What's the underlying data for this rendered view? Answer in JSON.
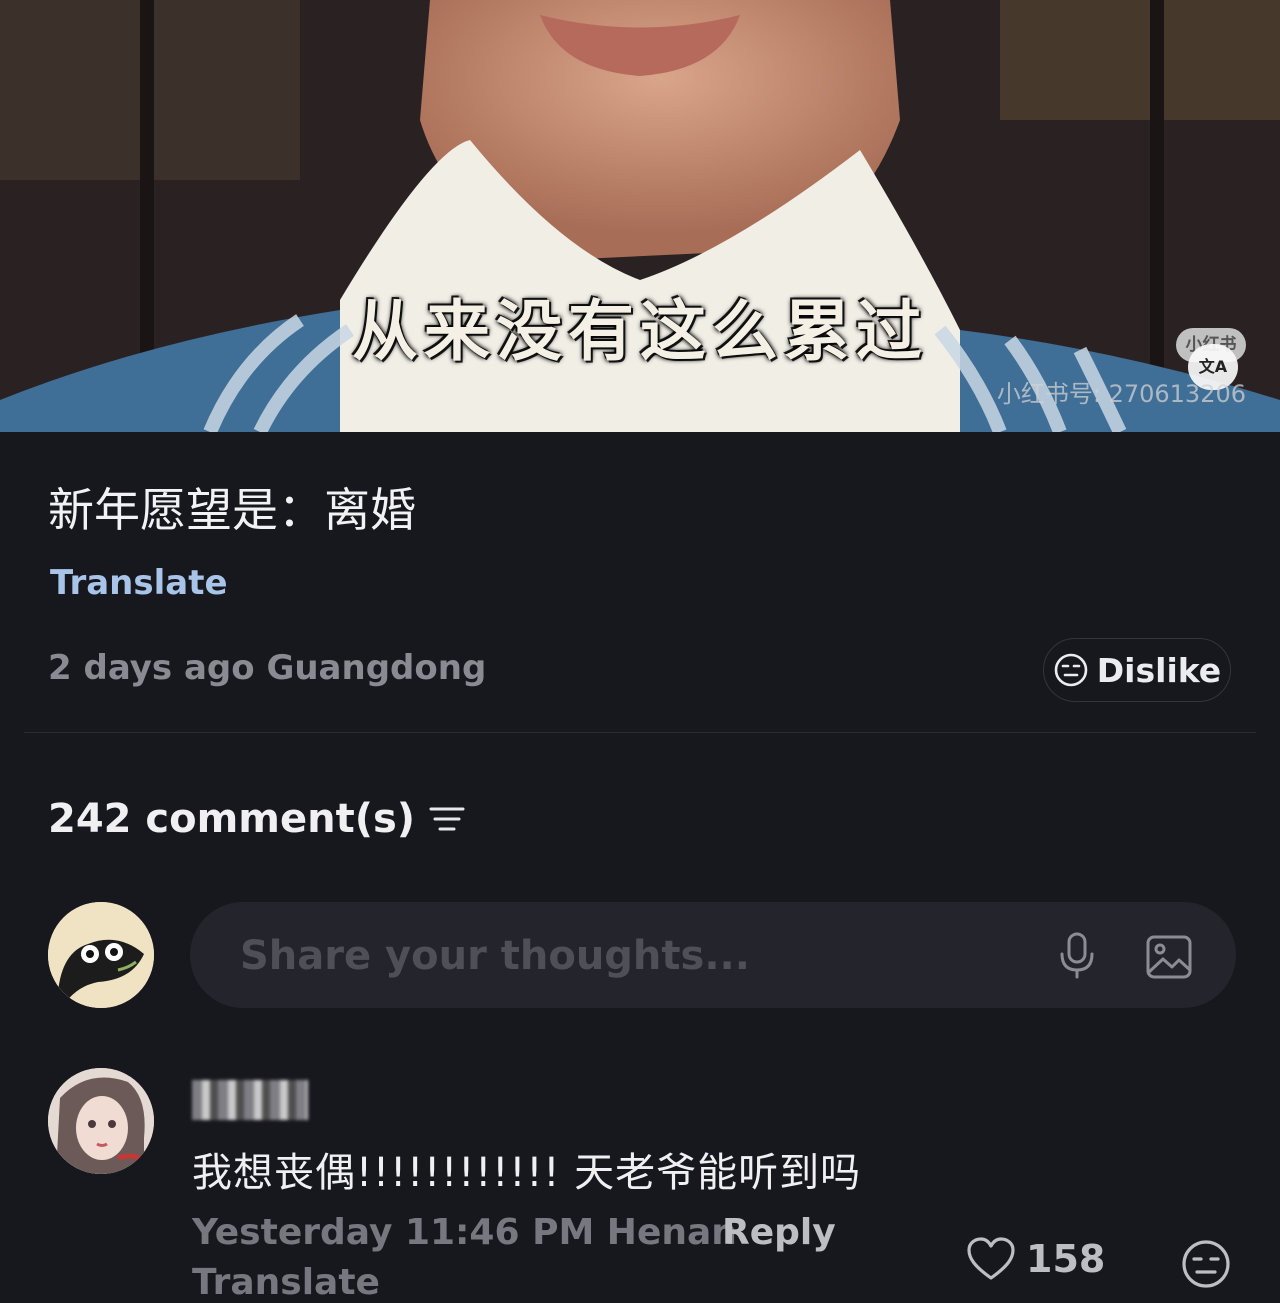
{
  "video": {
    "subtitle": "从来没有这么累过",
    "watermark_badge": "小红书",
    "watermark_id": "小红书号: 270613206",
    "translate_fab": "文A"
  },
  "post": {
    "title": "新年愿望是：离婚",
    "translate_label": "Translate",
    "meta": "2 days ago Guangdong",
    "dislike_label": "Dislike"
  },
  "comments": {
    "count_label": "242 comment(s)",
    "input_placeholder": "Share your thoughts...",
    "items": [
      {
        "text": "我想丧偶!!!!!!!!!!!! 天老爷能听到吗",
        "meta": "Yesterday 11:46 PM Henan",
        "reply_label": "Reply",
        "translate_label": "Translate",
        "likes": "158"
      }
    ]
  },
  "colors": {
    "background": "#17171e",
    "link": "#a8c4e8",
    "muted": "#8a8a92"
  }
}
